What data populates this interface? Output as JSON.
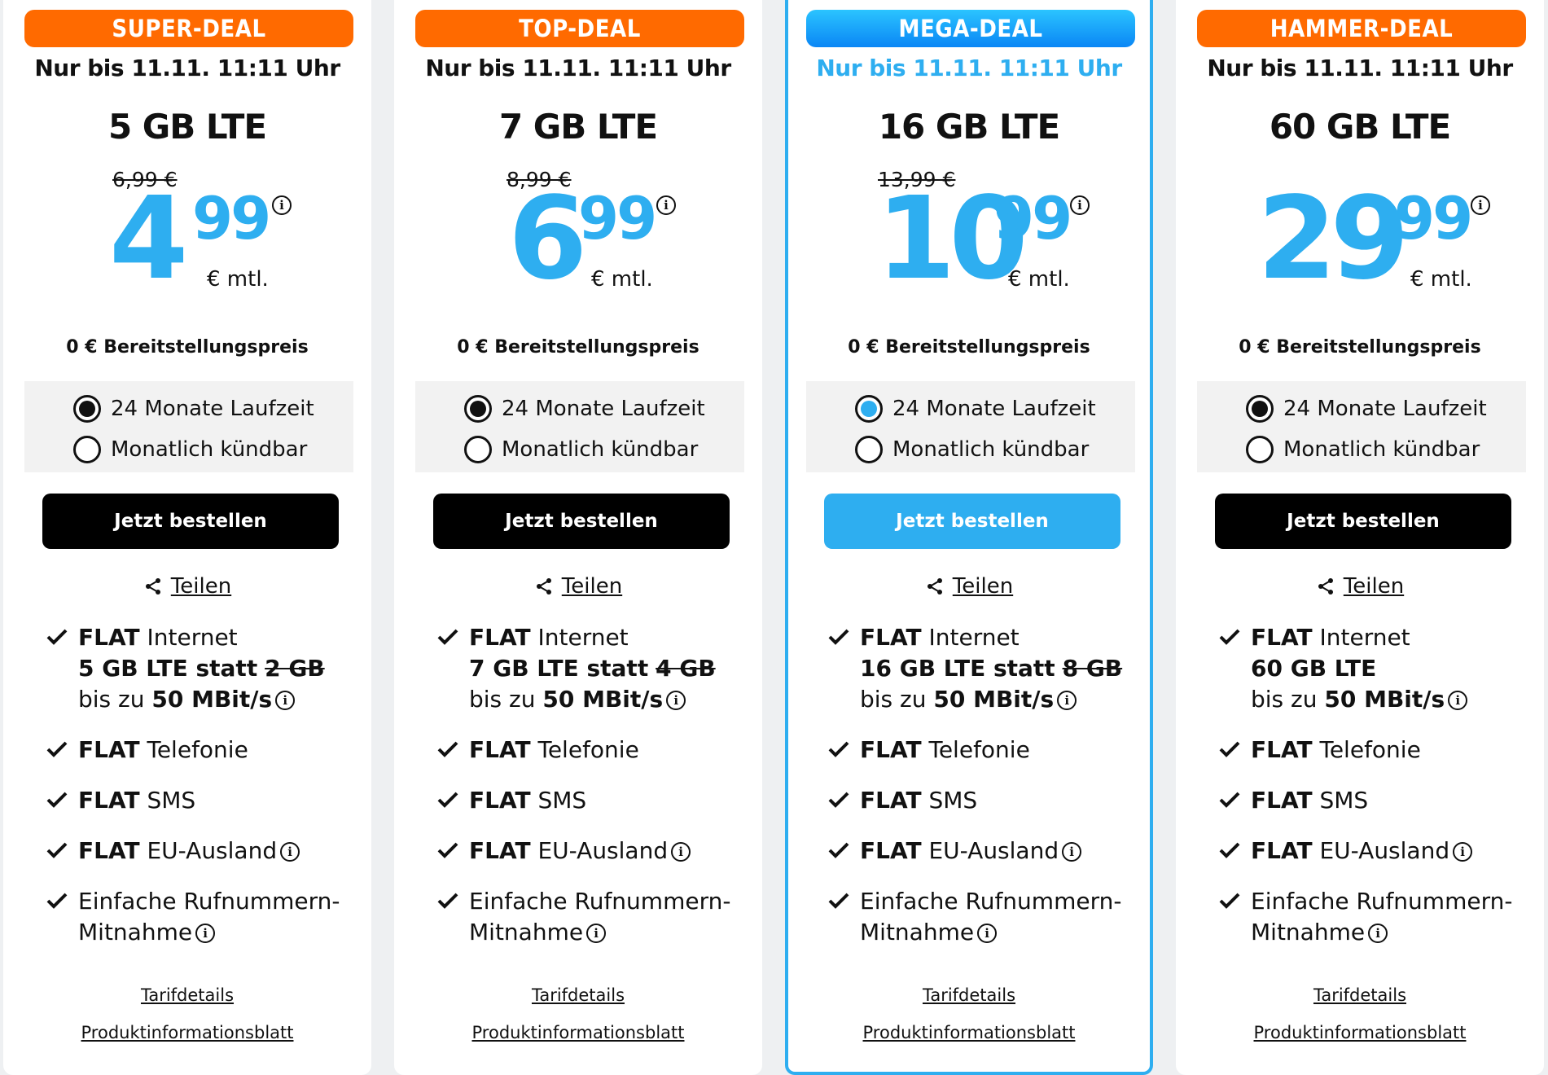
{
  "colors": {
    "accent": "#2eaef0",
    "badge_orange": "#ff6a00",
    "button_dark": "#000000"
  },
  "common": {
    "deadline": "Nur bis 11.11. 11:11 Uhr",
    "price_unit": "€ mtl.",
    "setup_fee": "0 € Bereitstellungspreis",
    "term_24": "24 Monate Laufzeit",
    "term_monthly": "Monatlich kündbar",
    "order_label": "Jetzt bestellen",
    "share_label": "Teilen",
    "details_link": "Tarifdetails",
    "pib_link": "Produktinformationsblatt",
    "info_glyph": "i",
    "features": {
      "internet_flat": "FLAT",
      "internet_word": "Internet",
      "speed_prefix": "bis zu",
      "speed_value": "50 MBit/s",
      "telefonie_flat": "FLAT",
      "telefonie_word": "Telefonie",
      "sms_flat": "FLAT",
      "sms_word": "SMS",
      "eu_flat": "FLAT",
      "eu_word": "EU-Ausland",
      "porting_line1": "Einfache Rufnummern-",
      "porting_line2": "Mitnahme"
    }
  },
  "cards": [
    {
      "badge": "SUPER-DEAL",
      "badge_color": "orange",
      "volume": "5 GB LTE",
      "old_price": "6,99 €",
      "price_euros": "4",
      "price_cents": "99",
      "data_line_main": "5 GB LTE statt",
      "data_line_old": "2 GB",
      "selected_term": "24"
    },
    {
      "badge": "TOP-DEAL",
      "badge_color": "orange",
      "volume": "7 GB LTE",
      "old_price": "8,99 €",
      "price_euros": "6",
      "price_cents": "99",
      "data_line_main": "7 GB LTE statt",
      "data_line_old": "4 GB",
      "selected_term": "24"
    },
    {
      "badge": "MEGA-DEAL",
      "badge_color": "blue",
      "volume": "16 GB LTE",
      "old_price": "13,99 €",
      "price_euros": "10",
      "price_cents": "99",
      "data_line_main": "16 GB LTE statt",
      "data_line_old": "8 GB",
      "selected_term": "24"
    },
    {
      "badge": "HAMMER-DEAL",
      "badge_color": "orange",
      "volume": "60 GB LTE",
      "old_price": "",
      "price_euros": "29",
      "price_cents": "99",
      "data_line_main": "60 GB LTE",
      "data_line_old": "",
      "selected_term": "24"
    }
  ]
}
